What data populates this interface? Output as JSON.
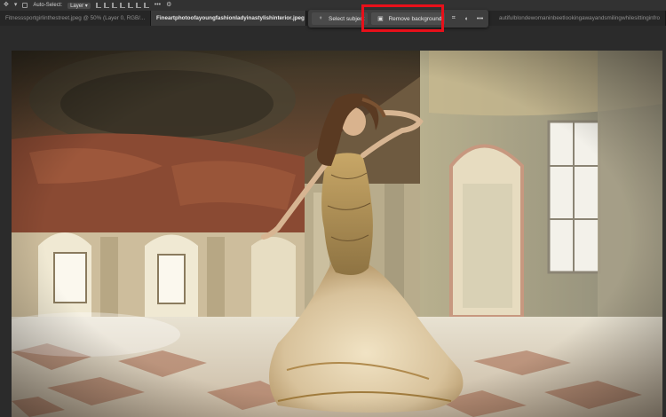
{
  "options_bar": {
    "auto_select_label": "Auto-Select:",
    "layer_select": "Layer",
    "more_label": "•••"
  },
  "tabs": [
    {
      "label": "Fitnesssportgirlinthestreet.jpeg @ 50% (Layer 0, RGB/...",
      "active": false
    },
    {
      "label": "Fineartphotoofayoungfashionladyinastylishinterior.jpeg",
      "active": true
    },
    {
      "label": "autifulblondewomaninbeetlookingawayandsmilingwhilesittinginfro",
      "active": false
    }
  ],
  "taskbar": {
    "select_subject_label": "Select subject",
    "remove_background_label": "Remove background",
    "more_label": "•••"
  },
  "colors": {
    "highlight": "#e8101a",
    "panel_bg": "#3e3e3e",
    "app_bg": "#2b2b2b"
  }
}
